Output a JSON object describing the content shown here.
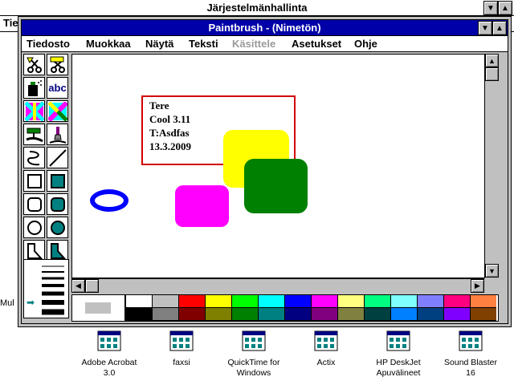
{
  "background_window": {
    "title": "Järjestelmänhallinta",
    "menu_fragment": "Tie",
    "left_fragment": "Mul"
  },
  "window": {
    "title": "Paintbrush - (Nimetön)",
    "menu": [
      "Tiedosto",
      "Muokkaa",
      "Näytä",
      "Teksti",
      "Käsittele",
      "Asetukset",
      "Ohje"
    ],
    "disabled_menu": "Käsittele"
  },
  "canvas": {
    "text_lines": [
      "Tere",
      "Cool 3.11",
      "T:Asdfas",
      "13.3.2009"
    ],
    "shape_colors": {
      "text_frame": "#d00000",
      "yellow_rect": "#ffff00",
      "green_rect": "#008000",
      "magenta_rect": "#ff00ff",
      "blue_ellipse": "#0000ff"
    }
  },
  "tools": [
    "scissors-icon",
    "pick-scissors-icon",
    "airbrush-icon",
    "text-tool-icon",
    "color-eraser-icon",
    "eraser-icon",
    "paint-roller-icon",
    "brush-icon",
    "curve-icon",
    "line-icon",
    "box-icon",
    "filled-box-icon",
    "rounded-box-icon",
    "filled-rounded-box-icon",
    "circle-icon",
    "filled-circle-icon",
    "polygon-icon",
    "filled-polygon-icon"
  ],
  "tool_text": "abc",
  "palette": {
    "foreground": "#000000",
    "background": "#ffffff",
    "top": [
      "#ffffff",
      "#c0c0c0",
      "#ff0000",
      "#ffff00",
      "#00ff00",
      "#00ffff",
      "#0000ff",
      "#ff00ff",
      "#ffff80",
      "#00ff80",
      "#80ffff",
      "#8080ff",
      "#ff0080",
      "#ff8040"
    ],
    "bottom": [
      "#000000",
      "#808080",
      "#800000",
      "#808000",
      "#008000",
      "#008080",
      "#000080",
      "#800080",
      "#808040",
      "#004040",
      "#0080ff",
      "#004080",
      "#8000ff",
      "#804000"
    ]
  },
  "desktop_icons": [
    {
      "label1": "Adobe Acrobat",
      "label2": "3.0"
    },
    {
      "label1": "faxsi",
      "label2": ""
    },
    {
      "label1": "QuickTime for",
      "label2": "Windows"
    },
    {
      "label1": "Actix",
      "label2": ""
    },
    {
      "label1": "HP DeskJet",
      "label2": "Apuvälineet"
    },
    {
      "label1": "Sound Blaster 16",
      "label2": ""
    }
  ]
}
